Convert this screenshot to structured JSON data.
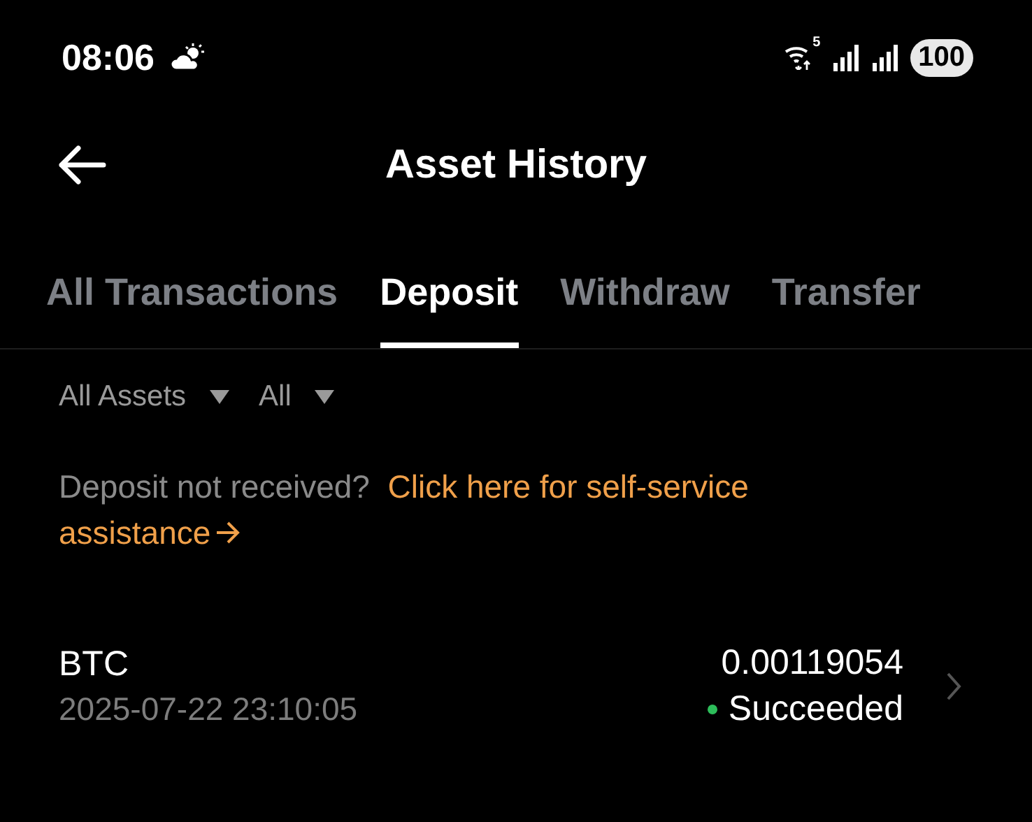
{
  "status_bar": {
    "time": "08:06",
    "network_badge": "5",
    "battery": "100"
  },
  "header": {
    "title": "Asset History"
  },
  "tabs": [
    {
      "label": "All Transactions",
      "selected": false
    },
    {
      "label": "Deposit",
      "selected": true
    },
    {
      "label": "Withdraw",
      "selected": false
    },
    {
      "label": "Transfer",
      "selected": false
    }
  ],
  "filters": [
    {
      "label": "All Assets"
    },
    {
      "label": "All"
    }
  ],
  "notice": {
    "text": "Deposit not received?",
    "link_lines": [
      "Click here for self-service",
      "assistance"
    ]
  },
  "records": [
    {
      "asset": "BTC",
      "time": "2025-07-22 23:10:05",
      "amount": "0.00119054",
      "status": "Succeeded",
      "color": "#2dbd5a"
    }
  ]
}
